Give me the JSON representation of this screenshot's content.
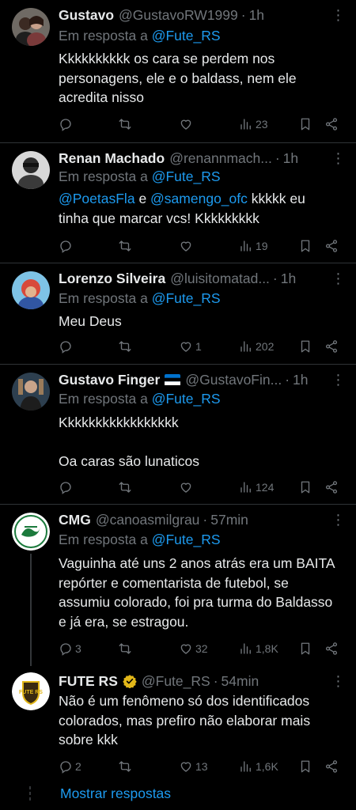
{
  "colors": {
    "background": "#000000",
    "text": "#e7e9ea",
    "muted": "#71767b",
    "link": "#1d9bf0",
    "divider": "#2f3336",
    "verified_gold": "#e2b719"
  },
  "reply_prefix": "Em resposta a",
  "tweets": [
    {
      "name": "Gustavo",
      "handle": "@GustavoRW1999",
      "time": "1h",
      "reply_to": "@Fute_RS",
      "text": "Kkkkkkkkkk os cara se perdem nos personagens, ele e o baldass, nem ele acredita nisso",
      "stats": {
        "replies": "",
        "retweets": "",
        "likes": "",
        "views": "23"
      }
    },
    {
      "name": "Renan Machado",
      "handle": "@renannmach...",
      "time": "1h",
      "reply_to": "@Fute_RS",
      "mention_1": "@PoetasFla",
      "connector": "e",
      "mention_2": "@samengo_ofc",
      "text_line_1_tail": "kkkkk eu",
      "text_line_2": "tinha que marcar vcs! Kkkkkkkkk",
      "stats": {
        "replies": "",
        "retweets": "",
        "likes": "",
        "views": "19"
      }
    },
    {
      "name": "Lorenzo Silveira",
      "handle": "@luisitomatad...",
      "time": "1h",
      "reply_to": "@Fute_RS",
      "text": "Meu Deus",
      "stats": {
        "replies": "",
        "retweets": "",
        "likes": "1",
        "views": "202"
      }
    },
    {
      "name": "Gustavo Finger",
      "handle": "@GustavoFin...",
      "time": "1h",
      "reply_to": "@Fute_RS",
      "text_line_1": "Kkkkkkkkkkkkkkkkk",
      "text_line_2": "Oa caras são lunaticos",
      "stats": {
        "replies": "",
        "retweets": "",
        "likes": "",
        "views": "124"
      }
    },
    {
      "name": "CMG",
      "handle": "@canoasmilgrau",
      "time": "57min",
      "reply_to": "@Fute_RS",
      "text": "Vaguinha até uns 2 anos atrás era um BAITA repórter e comentarista de futebol, se assumiu colorado, foi pra turma do Baldasso e já era, se estragou.",
      "stats": {
        "replies": "3",
        "retweets": "",
        "likes": "32",
        "views": "1,8K"
      }
    },
    {
      "name": "FUTE RS",
      "handle": "@Fute_RS",
      "time": "54min",
      "text": "Não é um fenômeno só dos identificados colorados, mas prefiro não elaborar mais sobre kkk",
      "stats": {
        "replies": "2",
        "retweets": "",
        "likes": "13",
        "views": "1,6K"
      }
    }
  ],
  "show_replies": "Mostrar respostas",
  "icons": [
    "reply-icon",
    "retweet-icon",
    "like-icon",
    "views-icon",
    "bookmark-icon",
    "share-icon",
    "more-icon",
    "verified-icon",
    "flag-icon"
  ]
}
